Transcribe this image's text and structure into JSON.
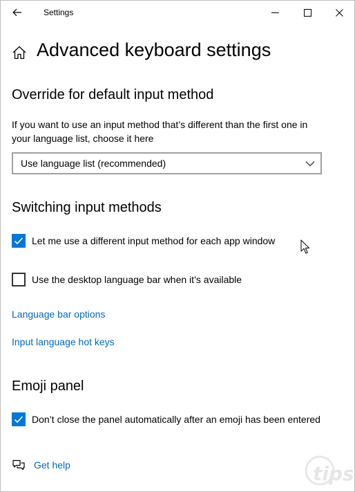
{
  "window": {
    "title": "Settings"
  },
  "page": {
    "title": "Advanced keyboard settings"
  },
  "override": {
    "heading": "Override for default input method",
    "description": "If you want to use an input method that’s different than the first one in your language list, choose it here",
    "dropdown_value": "Use language list (recommended)"
  },
  "switching": {
    "heading": "Switching input methods",
    "options": [
      {
        "label": "Let me use a different input method for each app window",
        "checked": true
      },
      {
        "label": "Use the desktop language bar when it’s available",
        "checked": false
      }
    ],
    "links": [
      {
        "label": "Language bar options"
      },
      {
        "label": "Input language hot keys"
      }
    ]
  },
  "emoji": {
    "heading": "Emoji panel",
    "option": {
      "label": "Don’t close the panel automatically after an emoji has been entered",
      "checked": true
    }
  },
  "help": {
    "label": "Get help"
  },
  "watermark": {
    "text": "tips"
  },
  "colors": {
    "accent": "#0078d7",
    "link": "#0067c0"
  },
  "icons": {
    "back": "back-arrow-icon",
    "home": "home-icon",
    "minimize": "minimize-icon",
    "maximize": "maximize-icon",
    "close": "close-icon",
    "chevron": "chevron-down-icon",
    "check": "checkmark-icon",
    "help": "chat-help-icon"
  }
}
